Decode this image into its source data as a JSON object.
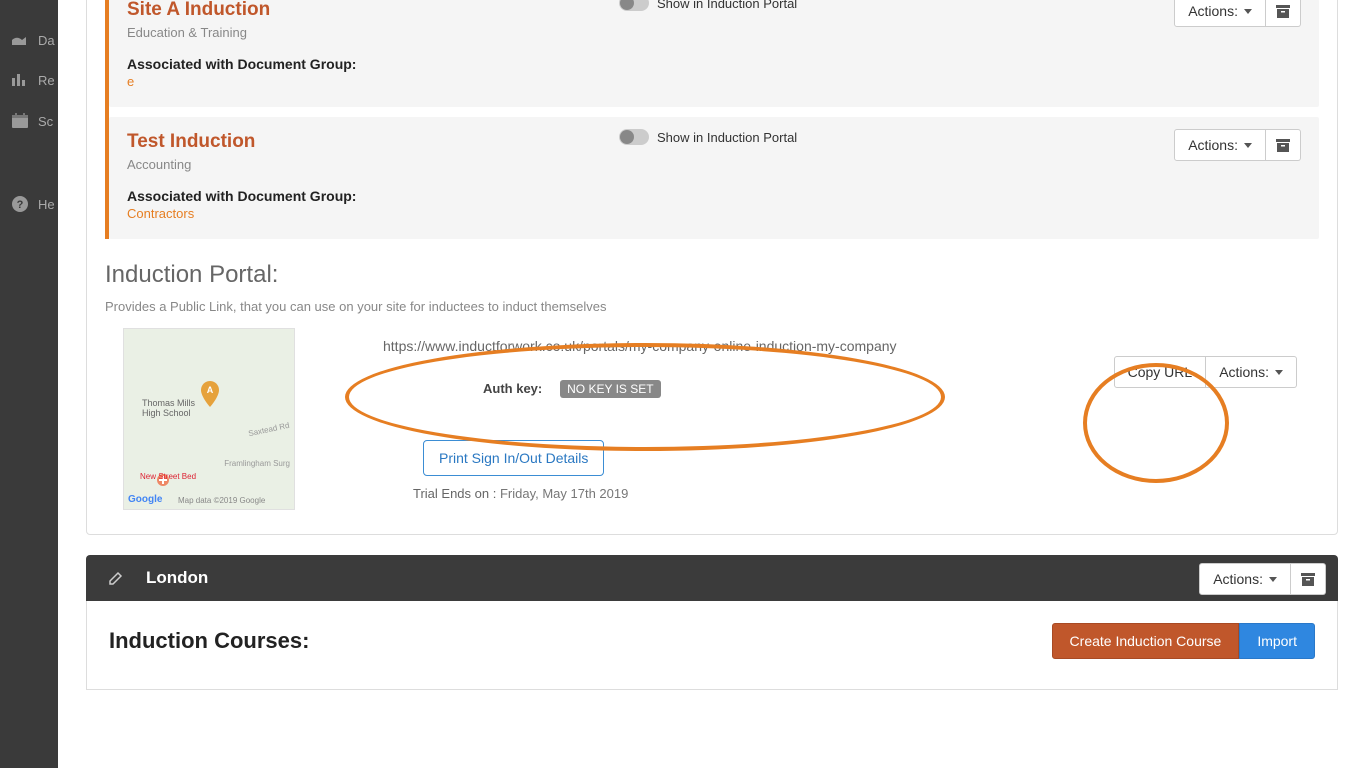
{
  "sidebar": {
    "items": [
      {
        "label": "Da"
      },
      {
        "label": "Re"
      },
      {
        "label": "Sc"
      },
      {
        "label": "He"
      }
    ]
  },
  "inductions": [
    {
      "title": "Site A Induction",
      "category": "Education & Training",
      "assoc_label": "Associated with Document Group:",
      "assoc_value": "e",
      "toggle_label": "Show in Induction Portal",
      "actions_label": "Actions:"
    },
    {
      "title": "Test Induction",
      "category": "Accounting",
      "assoc_label": "Associated with Document Group:",
      "assoc_value": "Contractors",
      "toggle_label": "Show in Induction Portal",
      "actions_label": "Actions:"
    }
  ],
  "portal": {
    "section_title": "Induction Portal:",
    "subtitle": "Provides a Public Link, that you can use on your site for inductees to induct themselves",
    "url": "https://www.inductforwork.co.uk/portals/my-company-online-induction-my-company",
    "auth_label": "Auth key:",
    "auth_badge": "NO KEY IS SET",
    "print_label": "Print Sign In/Out Details",
    "trial_label": "Trial Ends on :",
    "trial_value": "Friday, May 17th 2019",
    "copy_url": "Copy URL",
    "actions_label": "Actions:",
    "map": {
      "school": "Thomas Mills\nHigh School",
      "road1": "Saxtead Rd",
      "road2": "Framlingham Surg",
      "place": "New Street Bed",
      "logo": "Google",
      "attr": "Map data ©2019 Google"
    }
  },
  "london": {
    "name": "London",
    "actions_label": "Actions:",
    "courses_title": "Induction Courses:",
    "create_label": "Create Induction Course",
    "import_label": "Import"
  }
}
